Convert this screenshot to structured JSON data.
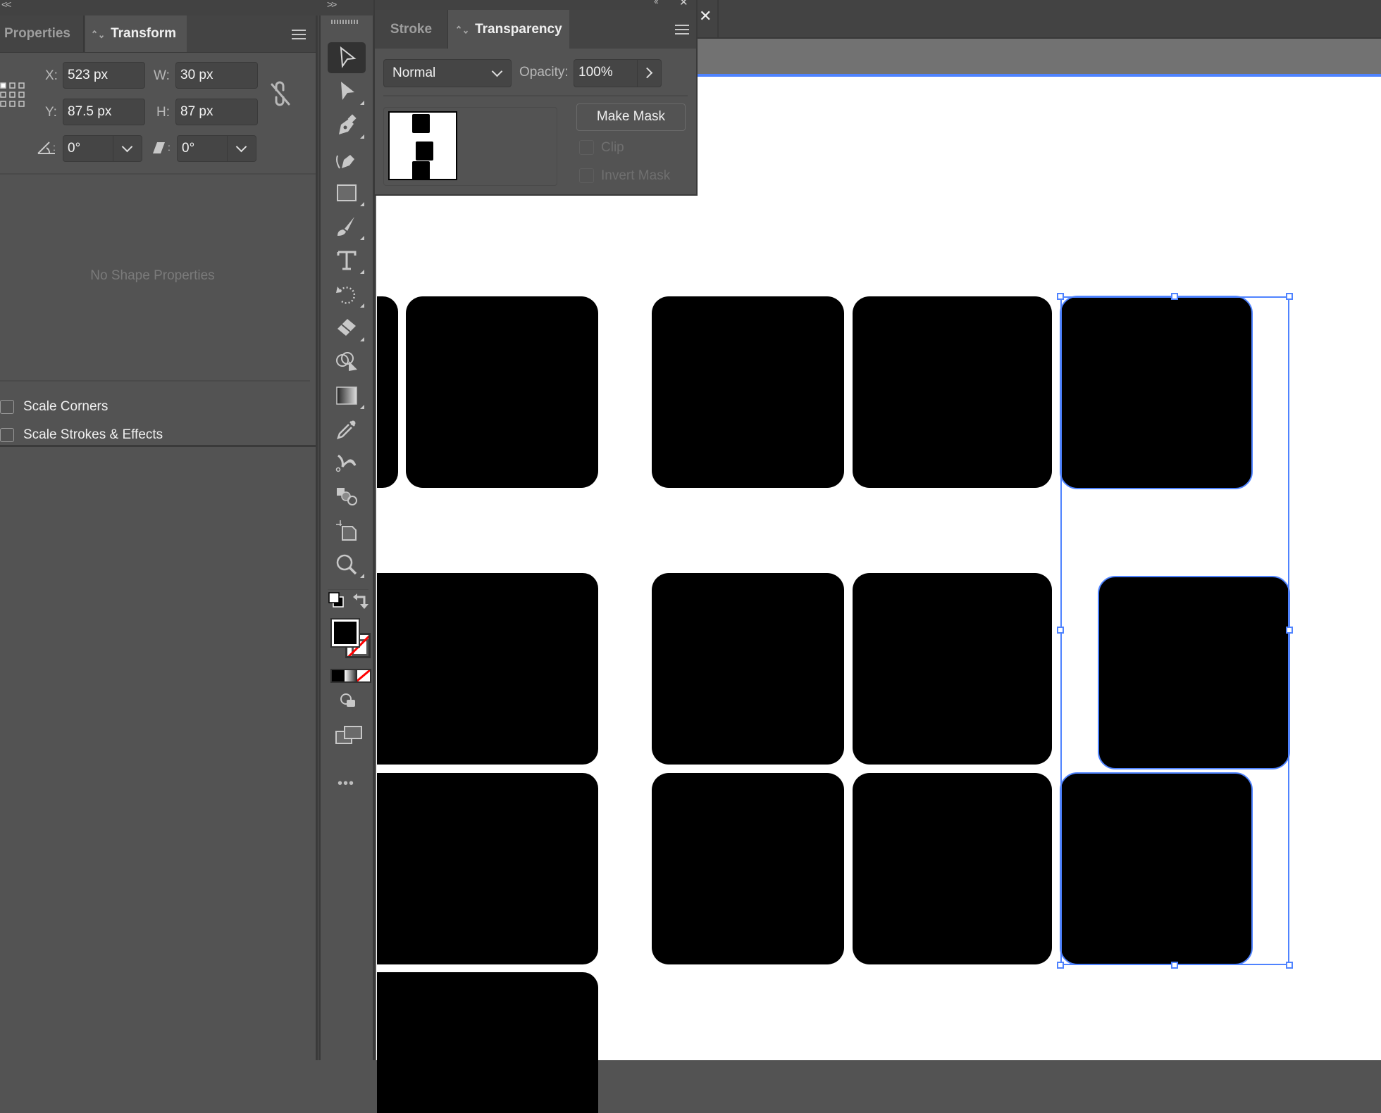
{
  "left_panel": {
    "collapse_glyph": "<<",
    "tabs": [
      {
        "label": "Properties",
        "active": false
      },
      {
        "label": "Transform",
        "active": true
      }
    ],
    "transform": {
      "x_label": "X:",
      "x_value": "523 px",
      "y_label": "Y:",
      "y_value": "87.5 px",
      "w_label": "W:",
      "w_value": "30 px",
      "h_label": "H:",
      "h_value": "87 px",
      "rotate_value": "0°",
      "shear_value": "0°"
    },
    "empty_message": "No Shape Properties",
    "options": [
      {
        "label": "Scale Corners",
        "checked": false
      },
      {
        "label": "Scale Strokes & Effects",
        "checked": false
      }
    ]
  },
  "toolbar": {
    "expand_glyph": ">>",
    "tools": [
      {
        "name": "selection-tool",
        "active": true
      },
      {
        "name": "direct-selection-tool"
      },
      {
        "name": "pen-tool"
      },
      {
        "name": "curvature-tool"
      },
      {
        "name": "rectangle-tool"
      },
      {
        "name": "paintbrush-tool"
      },
      {
        "name": "type-tool"
      },
      {
        "name": "rotate-tool"
      },
      {
        "name": "eraser-tool"
      },
      {
        "name": "shape-builder-tool"
      },
      {
        "name": "gradient-tool"
      },
      {
        "name": "eyedropper-tool"
      },
      {
        "name": "puppet-warp-tool"
      },
      {
        "name": "blend-tool"
      },
      {
        "name": "artboard-tool"
      },
      {
        "name": "zoom-tool"
      }
    ],
    "fill_color": "#000000",
    "stroke_color": "none",
    "more_glyph": "•••"
  },
  "transparency_panel": {
    "tabs": [
      {
        "label": "Stroke",
        "active": false
      },
      {
        "label": "Transparency",
        "active": true
      }
    ],
    "blend_mode": "Normal",
    "opacity_label": "Opacity:",
    "opacity_value": "100%",
    "make_mask_label": "Make Mask",
    "clip_label": "Clip",
    "clip_checked": false,
    "invert_mask_label": "Invert Mask",
    "invert_mask_checked": false
  },
  "document": {
    "close_glyph": "✕",
    "selection_color": "#4f83ff"
  }
}
